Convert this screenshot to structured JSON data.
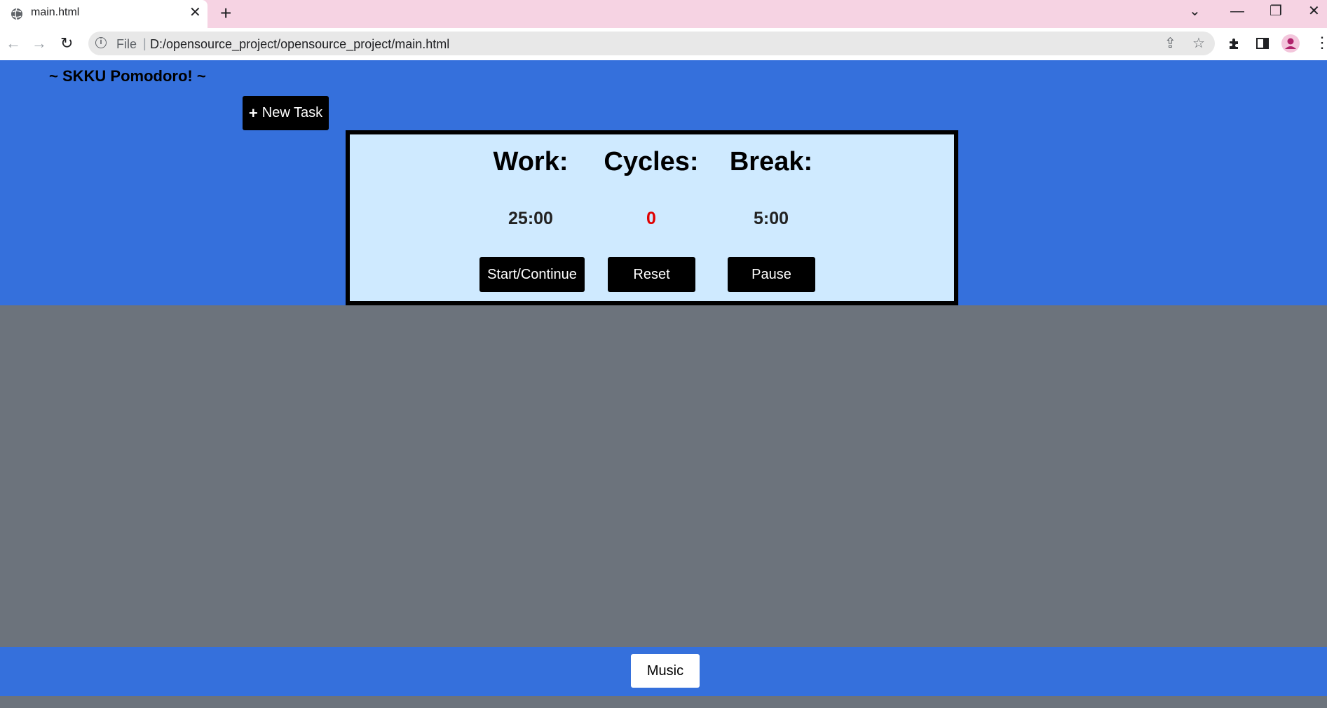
{
  "browser": {
    "tab_title": "main.html",
    "tab_close": "✕",
    "new_tab": "+",
    "win_chevron": "⌄",
    "win_minimize": "—",
    "win_restore": "❐",
    "win_close": "✕",
    "back": "←",
    "forward": "→",
    "reload": "↻",
    "info": "i",
    "scheme_label": "File",
    "separator": "|",
    "url": "D:/opensource_project/opensource_project/main.html",
    "share": "⇪",
    "bookmark": "☆",
    "menu": "⋮"
  },
  "app": {
    "title": "~ SKKU Pomodoro! ~",
    "new_task_icon": "+",
    "new_task_label": "New Task"
  },
  "timer": {
    "work_label": "Work:",
    "cycles_label": "Cycles:",
    "break_label": "Break:",
    "work_time": "25:00",
    "cycles": "0",
    "break_time": "5:00",
    "start_label": "Start/Continue",
    "reset_label": "Reset",
    "pause_label": "Pause"
  },
  "footer": {
    "music_label": "Music"
  },
  "colors": {
    "band": "#3570dc",
    "page_bg": "#6c737c",
    "timer_bg": "#cfeaff",
    "cycles_color": "#e00000",
    "tabstrip": "#f6d3e3"
  }
}
